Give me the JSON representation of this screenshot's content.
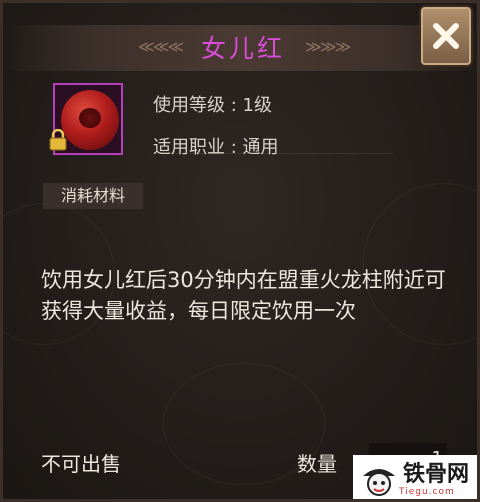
{
  "dialog": {
    "title": "女儿红",
    "item_icon": "wine-jar-icon",
    "lock_icon": "lock-icon",
    "use_level": "使用等级 : 1级",
    "applicable_class": "适用职业 : 通用",
    "category_tag": "消耗材料",
    "description": "饮用女儿红后30分钟内在盟重火龙柱附近可获得大量收益，每日限定饮用一次",
    "sell_status": "不可出售",
    "quantity_label": "数量",
    "quantity_value": "1",
    "close_icon": "close-icon"
  },
  "watermark": {
    "name": "铁骨网",
    "sub": "Tiegu.com"
  },
  "colors": {
    "title": "#d84cd8",
    "icon_border": "#b43fb9",
    "close_button": "#9c7c5a"
  }
}
